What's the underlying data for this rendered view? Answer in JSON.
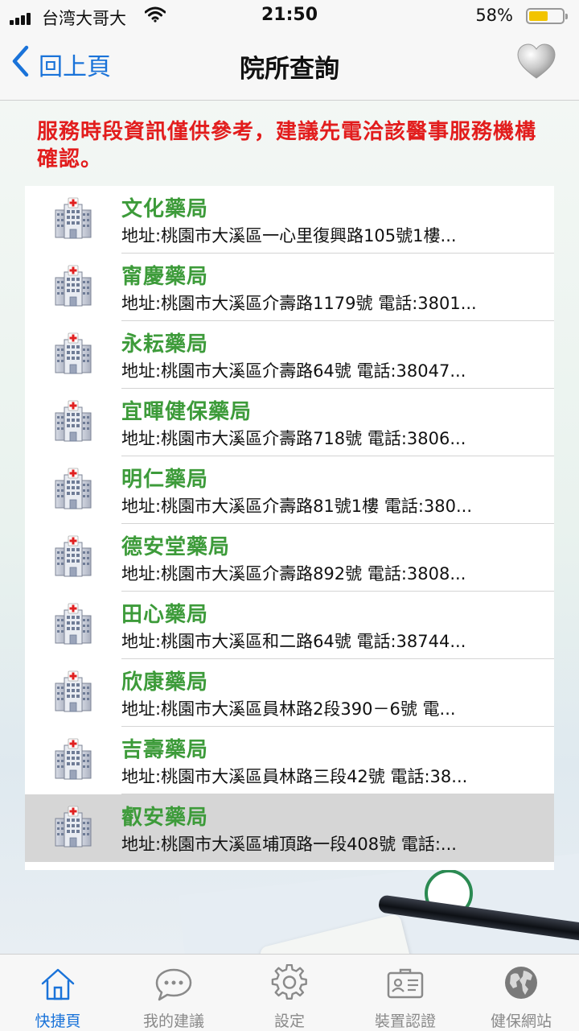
{
  "status_bar": {
    "carrier": "台湾大哥大",
    "time": "21:50",
    "battery_percent": "58%",
    "battery_level": 0.58
  },
  "nav": {
    "back_label": "回上頁",
    "title": "院所查詢",
    "favorite_icon": "heart-icon"
  },
  "notice": "服務時段資訊僅供參考，建議先電洽該醫事服務機構確認。",
  "pharmacies": [
    {
      "name": "文化藥局",
      "address": "地址:桃園市大溪區一心里復興路105號1樓..."
    },
    {
      "name": "甯慶藥局",
      "address": "地址:桃園市大溪區介壽路1179號 電話:3801..."
    },
    {
      "name": "永耘藥局",
      "address": "地址:桃園市大溪區介壽路64號 電話:38047..."
    },
    {
      "name": "宜暉健保藥局",
      "address": "地址:桃園市大溪區介壽路718號 電話:3806..."
    },
    {
      "name": "明仁藥局",
      "address": "地址:桃園市大溪區介壽路81號1樓 電話:380..."
    },
    {
      "name": "德安堂藥局",
      "address": "地址:桃園市大溪區介壽路892號 電話:3808..."
    },
    {
      "name": "田心藥局",
      "address": "地址:桃園市大溪區和二路64號 電話:38744..."
    },
    {
      "name": "欣康藥局",
      "address": "地址:桃園市大溪區員林路2段390－6號 電..."
    },
    {
      "name": "吉壽藥局",
      "address": "地址:桃園市大溪區員林路三段42號 電話:38..."
    },
    {
      "name": "叡安藥局",
      "address": "地址:桃園市大溪區埔頂路一段408號 電話:..."
    }
  ],
  "tabs": [
    {
      "label": "快捷頁",
      "icon": "home-icon"
    },
    {
      "label": "我的建議",
      "icon": "chat-bubble-icon"
    },
    {
      "label": "設定",
      "icon": "gear-icon"
    },
    {
      "label": "裝置認證",
      "icon": "id-card-icon"
    },
    {
      "label": "健保網站",
      "icon": "globe-icon"
    }
  ],
  "colors": {
    "accent": "#1a73d9",
    "notice": "#e21d1d",
    "pharmacy_name": "#3d9b3a",
    "selected_row": "#d6d6d6"
  }
}
